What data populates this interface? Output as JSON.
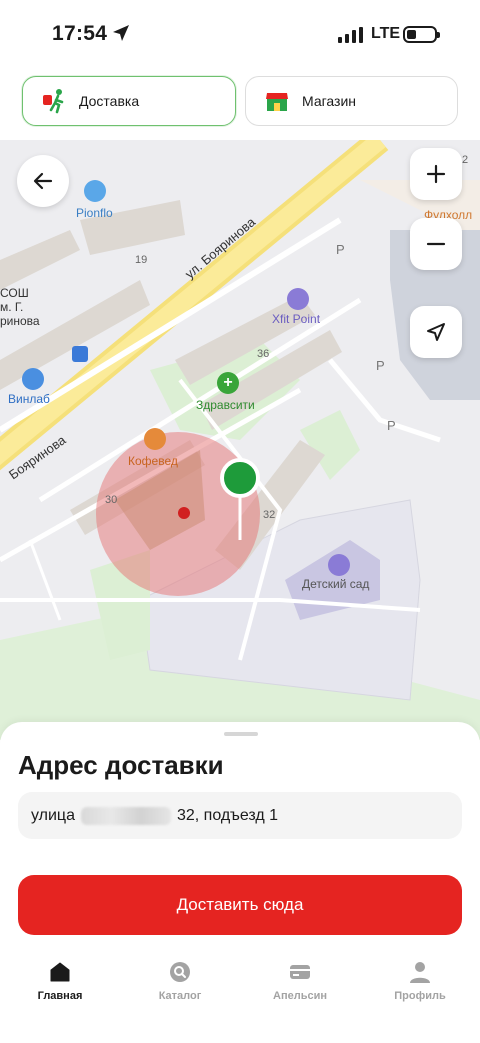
{
  "status": {
    "time": "17:54",
    "network": "LTE"
  },
  "modes": {
    "delivery_label": "Доставка",
    "store_label": "Магазин"
  },
  "map": {
    "street_main": "ул. Бояринова",
    "street_main_2": "Бояринова",
    "street_left_fragment": "ринова",
    "house_19": "19",
    "house_36": "36",
    "house_30": "30",
    "house_32": "32",
    "house_2": "2",
    "poi_pionflo": "Pionflo",
    "poi_xfit": "Xfit Point",
    "poi_zdravsiti": "Здравсити",
    "poi_kofeved": "Кофевед",
    "poi_vinlab": "Винлаб",
    "poi_kindergarten": "Детский сад",
    "poi_fullhall": "Фулхолл",
    "school_line1": "СОШ",
    "school_line2": "м. Г.",
    "parking": "P",
    "colors": {
      "pin": "#1e9b3a",
      "zone": "#e57373",
      "accent": "#e52421"
    }
  },
  "sheet": {
    "title": "Адрес доставки",
    "address_prefix": "улица",
    "address_suffix": "32, подъезд 1",
    "cta_label": "Доставить сюда"
  },
  "tabs": [
    {
      "label": "Главная",
      "icon": "home-icon",
      "active": true
    },
    {
      "label": "Каталог",
      "icon": "catalog-search-icon",
      "active": false
    },
    {
      "label": "Апельсин",
      "icon": "card-icon",
      "active": false
    },
    {
      "label": "Профиль",
      "icon": "profile-icon",
      "active": false
    }
  ]
}
